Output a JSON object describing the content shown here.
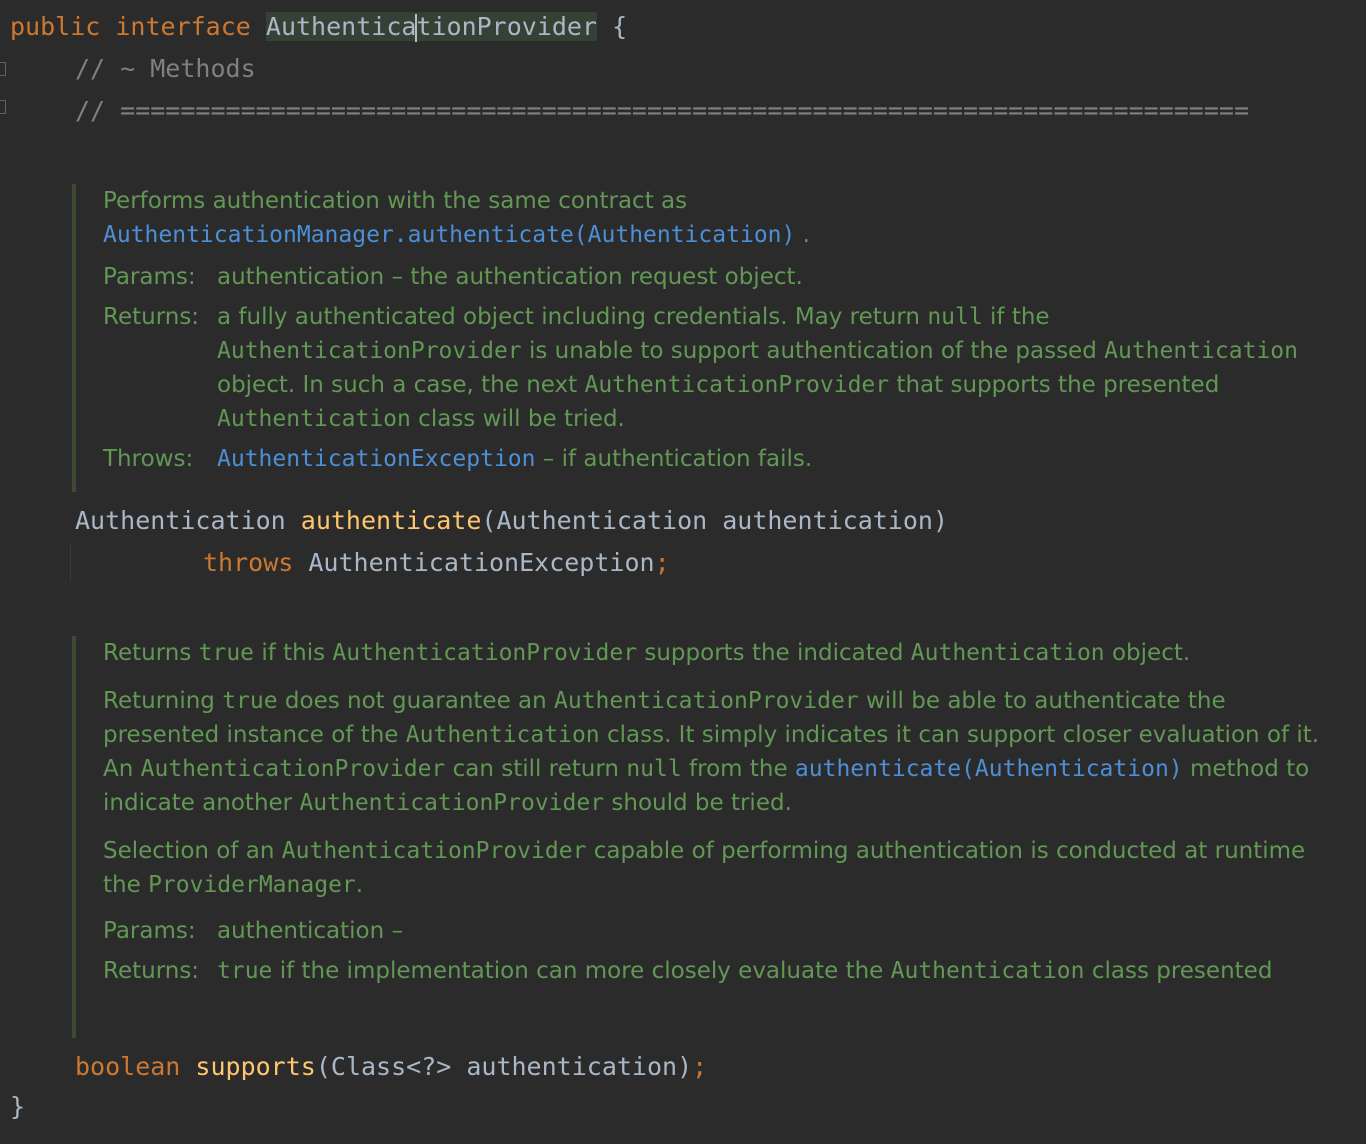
{
  "decl": {
    "kw_public": "public",
    "kw_interface": "interface",
    "name_left": "Authentica",
    "name_right": "tionProvider",
    "open_brace": "{"
  },
  "comments": {
    "methods": "// ~ Methods",
    "separator": "// ==========================================================================="
  },
  "doc1": {
    "summary_a": "Performs authentication with the same contract as ",
    "summary_link": "AuthenticationManager.authenticate(Authentication)",
    "summary_b": " .",
    "params_tag": "Params:",
    "params_name": "authentication",
    "params_desc": " – the authentication request object.",
    "returns_tag": "Returns:",
    "returns_a": "a fully authenticated object including credentials. May return ",
    "returns_null": "null",
    "returns_b": " if the ",
    "returns_code1": "AuthenticationProvider",
    "returns_c": " is unable to support authentication of the passed ",
    "returns_code2": "Authentication",
    "returns_d": " object. In such a case, the next ",
    "returns_code3": "AuthenticationProvider",
    "returns_e": " that supports the presented ",
    "returns_code4": "Authentication",
    "returns_f": " class will be tried.",
    "throws_tag": "Throws:",
    "throws_link": "AuthenticationException",
    "throws_desc": " – if authentication fails."
  },
  "method1": {
    "return_type": "Authentication",
    "name": "authenticate",
    "params": "(Authentication authentication)",
    "kw_throws": "throws",
    "exception": "AuthenticationException",
    "semicolon": ";"
  },
  "doc2": {
    "p1_a": "Returns ",
    "p1_true": "true",
    "p1_b": " if this ",
    "p1_code1": "AuthenticationProvider",
    "p1_c": " supports the indicated ",
    "p1_code2": "Authentication",
    "p1_d": " object.",
    "p2_a": "Returning ",
    "p2_true": "true",
    "p2_b": " does not guarantee an ",
    "p2_code1": "AuthenticationProvider",
    "p2_c": " will be able to authenticate the presented instance of the ",
    "p2_code2": "Authentication",
    "p2_d": " class. It simply indicates it can support closer evaluation of it. An ",
    "p2_code3": "AuthenticationProvider",
    "p2_e": " can still return ",
    "p2_null": "null",
    "p2_f": " from the ",
    "p2_link": "authenticate(Authentication)",
    "p2_g": " method to indicate another ",
    "p2_code4": "AuthenticationProvider",
    "p2_h": " should be tried.",
    "p3_a": "Selection of an ",
    "p3_code1": "AuthenticationProvider",
    "p3_b": " capable of performing authentication is conducted at runtime the ",
    "p3_code2": "ProviderManager",
    "p3_c": ".",
    "params_tag": "Params:",
    "params_name": "authentication",
    "params_desc": " –",
    "returns_tag": "Returns:",
    "returns_true": "true",
    "returns_a": " if the implementation can more closely evaluate the ",
    "returns_code": "Authentication",
    "returns_b": " class presented"
  },
  "method2": {
    "kw_boolean": "boolean",
    "name": "supports",
    "params": "(Class<?> authentication)",
    "semicolon": ";"
  },
  "close_brace": "}"
}
